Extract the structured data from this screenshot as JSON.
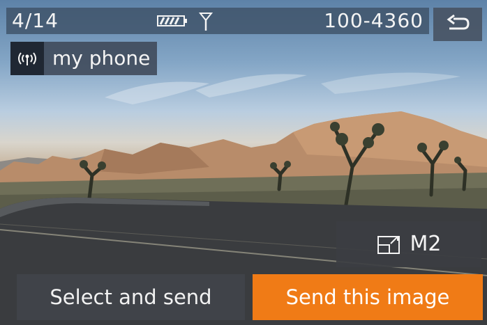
{
  "status_bar": {
    "frame_counter": "4/14",
    "file_number": "100-4360",
    "battery_icon": "battery-icon",
    "antenna_icon": "antenna-icon"
  },
  "back_button": {
    "icon": "return-arrow-icon"
  },
  "connection": {
    "icon": "wifi-signal-icon",
    "device_name": "my phone"
  },
  "transfer_size": {
    "icon": "image-resize-icon",
    "label": "M2"
  },
  "actions": {
    "select_and_send": "Select and send",
    "send_this_image": "Send this image"
  },
  "colors": {
    "accent": "#f07b16",
    "button_dark": "#404349",
    "status_bar": "#3e5268"
  }
}
